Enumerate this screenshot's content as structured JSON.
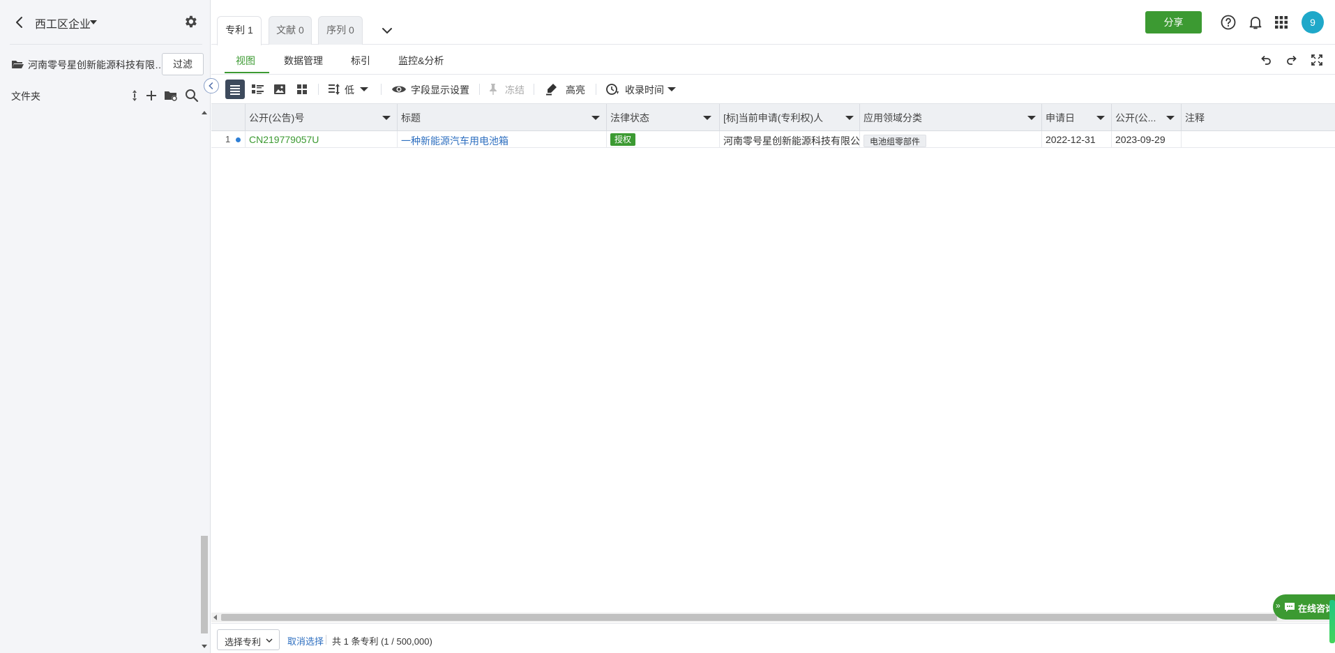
{
  "sidebar": {
    "title": "西工区企业",
    "company": "河南零号星创新能源科技有限公司",
    "filter_label": "过滤",
    "folder_label": "文件夹"
  },
  "tabs": [
    {
      "label": "专利 1",
      "active": true
    },
    {
      "label": "文献 0",
      "active": false
    },
    {
      "label": "序列 0",
      "active": false
    }
  ],
  "header": {
    "share_label": "分享",
    "avatar_text": "9"
  },
  "subnav": {
    "items": [
      {
        "label": "视图",
        "active": true
      },
      {
        "label": "数据管理",
        "active": false
      },
      {
        "label": "标引",
        "active": false
      },
      {
        "label": "监控&分析",
        "active": false
      }
    ]
  },
  "toolbar": {
    "density_label": "低",
    "fields_label": "字段显示设置",
    "freeze_label": "冻结",
    "highlight_label": "高亮",
    "sort_label": "收录时间"
  },
  "table": {
    "columns": [
      "公开(公告)号",
      "标题",
      "法律状态",
      "[标]当前申请(专利权)人",
      "应用领域分类",
      "申请日",
      "公开(公...",
      "注释"
    ],
    "rows": [
      {
        "index": "1",
        "pub_no": "CN219779057U",
        "title": "一种新能源汽车用电池箱",
        "legal_status": "授权",
        "applicant": "河南零号星创新能源科技有限公",
        "field": "电池组零部件",
        "app_date": "2022-12-31",
        "pub_date": "2023-09-29",
        "note": ""
      }
    ]
  },
  "footer": {
    "select_label": "选择专利",
    "cancel_label": "取消选择",
    "count_text": "共 1 条专利 (1 / 500,000)"
  },
  "chat": {
    "label": "在线咨询"
  },
  "colors": {
    "accent": "#3c9a32",
    "link": "#2e6fc0",
    "avatar": "#1fa8c9"
  }
}
